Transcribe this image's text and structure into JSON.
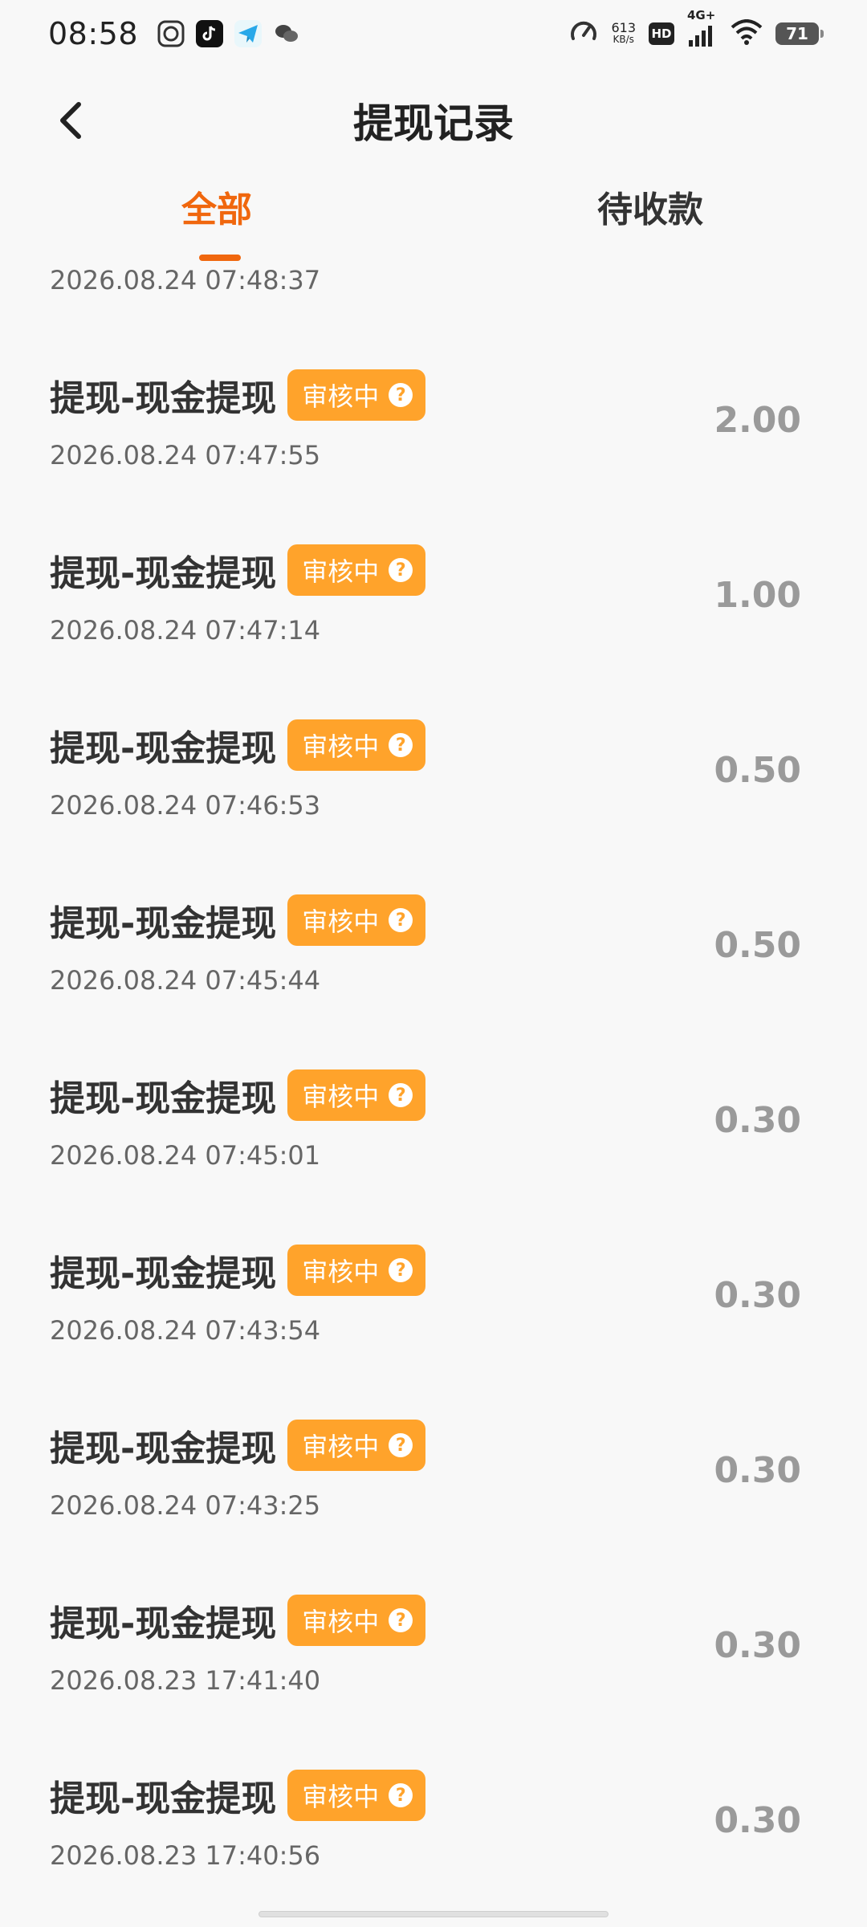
{
  "status_bar": {
    "time": "08:58",
    "net_speed_value": "613",
    "net_speed_unit": "KB/s",
    "hd_label": "HD",
    "network_type": "4G+",
    "battery": "71",
    "app_icons": [
      "face-app-icon",
      "tiktok-icon",
      "telegram-icon",
      "wechat-icon"
    ]
  },
  "header": {
    "title": "提现记录"
  },
  "tabs": [
    {
      "label": "全部",
      "active": true
    },
    {
      "label": "待收款",
      "active": false
    }
  ],
  "partial_record": {
    "date": "2026.08.24 07:48:37"
  },
  "records": [
    {
      "title": "提现-现金提现",
      "status": "审核中",
      "date": "2026.08.24 07:47:55",
      "amount": "2.00"
    },
    {
      "title": "提现-现金提现",
      "status": "审核中",
      "date": "2026.08.24 07:47:14",
      "amount": "1.00"
    },
    {
      "title": "提现-现金提现",
      "status": "审核中",
      "date": "2026.08.24 07:46:53",
      "amount": "0.50"
    },
    {
      "title": "提现-现金提现",
      "status": "审核中",
      "date": "2026.08.24 07:45:44",
      "amount": "0.50"
    },
    {
      "title": "提现-现金提现",
      "status": "审核中",
      "date": "2026.08.24 07:45:01",
      "amount": "0.30"
    },
    {
      "title": "提现-现金提现",
      "status": "审核中",
      "date": "2026.08.24 07:43:54",
      "amount": "0.30"
    },
    {
      "title": "提现-现金提现",
      "status": "审核中",
      "date": "2026.08.24 07:43:25",
      "amount": "0.30"
    },
    {
      "title": "提现-现金提现",
      "status": "审核中",
      "date": "2026.08.23 17:41:40",
      "amount": "0.30"
    },
    {
      "title": "提现-现金提现",
      "status": "审核中",
      "date": "2026.08.23 17:40:56",
      "amount": "0.30"
    }
  ],
  "colors": {
    "accent": "#f0670e",
    "badge": "#ffa32b",
    "amount": "#9a9a9a"
  }
}
